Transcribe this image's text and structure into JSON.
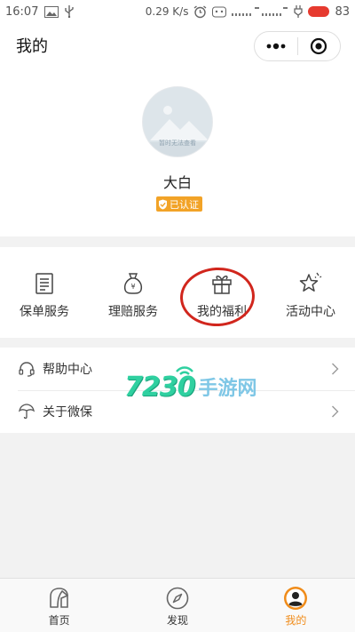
{
  "status_bar": {
    "time": "16:07",
    "net_speed": "0.29 K/s",
    "battery": "83"
  },
  "header": {
    "title": "我的"
  },
  "profile": {
    "avatar_caption": "暂时无法查看",
    "name": "大白",
    "verified_label": "已认证"
  },
  "services": [
    {
      "label": "保单服务",
      "icon": "document-icon"
    },
    {
      "label": "理赔服务",
      "icon": "money-bag-icon"
    },
    {
      "label": "我的福利",
      "icon": "gift-icon"
    },
    {
      "label": "活动中心",
      "icon": "star-icon"
    }
  ],
  "menu": [
    {
      "label": "帮助中心",
      "icon": "headset-icon"
    },
    {
      "label": "关于微保",
      "icon": "umbrella-icon"
    }
  ],
  "watermark": {
    "number": "7230",
    "text": "手游网"
  },
  "tabs": [
    {
      "label": "首页",
      "icon": "home-icon",
      "active": false
    },
    {
      "label": "发现",
      "icon": "compass-icon",
      "active": false
    },
    {
      "label": "我的",
      "icon": "profile-icon",
      "active": true
    }
  ],
  "colors": {
    "accent": "#f08c1a",
    "badge": "#f2a327",
    "highlight_ring": "#d1261d",
    "battery": "#e63a2f"
  }
}
